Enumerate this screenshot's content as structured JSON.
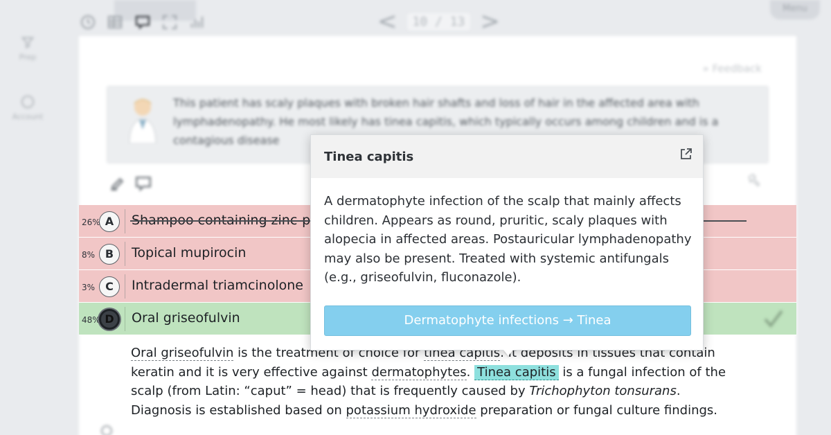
{
  "topbar": {
    "page_current": "10",
    "page_separator": "/",
    "page_total": "13",
    "menu_label": "Menu"
  },
  "leftnav": {
    "items": [
      {
        "label": "Prep"
      },
      {
        "label": "Account"
      }
    ]
  },
  "question": {
    "feedback_label": "» Feedback",
    "callout_text": "This patient has scaly plaques with broken hair shafts and loss of hair in the affected area with lymphadenopathy. He most likely has tinea capitis, which typically occurs among children and is a contagious disease"
  },
  "answers": [
    {
      "percent": "26%",
      "letter": "A",
      "text": "Shampoo containing zinc-py",
      "state": "wrong"
    },
    {
      "percent": "8%",
      "letter": "B",
      "text": "Topical mupirocin",
      "state": "wrong"
    },
    {
      "percent": "3%",
      "letter": "C",
      "text": "Intradermal triamcinolone",
      "state": "wrong"
    },
    {
      "percent": "48%",
      "letter": "D",
      "text": "Oral griseofulvin",
      "state": "correct"
    }
  ],
  "explanation": {
    "p1_link": "Oral griseofulvin",
    "p1_text": " is the treatment of choice for ",
    "p1_link2": "tinea capitis",
    "p1_text2": ". It deposits in tissues that contain keratin and it is very effective against ",
    "p1_link3": "dermatophytes",
    "p1_text3": ". ",
    "highlight": "Tinea capitis",
    "p1_text4": " is a fungal infection of the scalp (from Latin: “caput” = head) that is frequently caused by ",
    "organism": "Trichophyton tonsurans",
    "p1_text5": ". Diagnosis is established based on ",
    "p1_link4": "potassium hydroxide",
    "p1_text6": " preparation or fungal culture findings."
  },
  "popup": {
    "title": "Tinea capitis",
    "body": "A dermatophyte infection of the scalp that mainly affects children. Appears as round, pruritic, scaly plaques with alopecia in affected areas. Postauricular lymphadenopathy may also be present. Treated with systemic antifungals (e.g., griseofulvin, fluconazole).",
    "link_label": "Dermatophyte infections → Tinea"
  },
  "colors": {
    "wrong_row": "#f1c6c6",
    "correct_row": "#bfe3be",
    "highlight": "#8ee0de",
    "popup_button": "#84cfee"
  }
}
